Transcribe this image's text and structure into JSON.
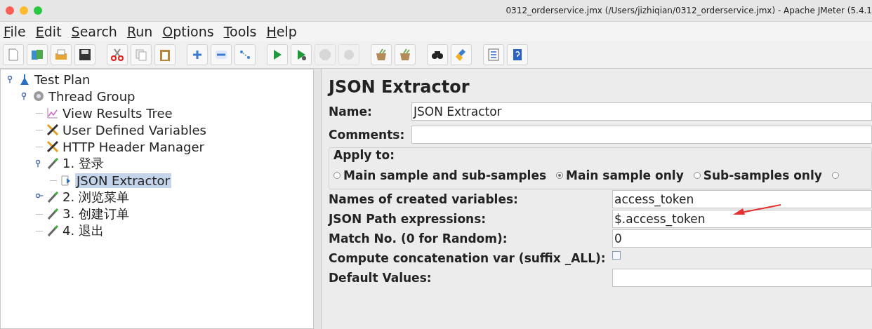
{
  "window": {
    "title": "0312_orderservice.jmx (/Users/jizhiqian/0312_orderservice.jmx) - Apache JMeter (5.4.1"
  },
  "menu": [
    "File",
    "Edit",
    "Search",
    "Run",
    "Options",
    "Tools",
    "Help"
  ],
  "toolbar": [
    {
      "kind": "new",
      "disabled": false
    },
    {
      "kind": "templates",
      "disabled": false
    },
    {
      "kind": "open",
      "disabled": false
    },
    {
      "kind": "save",
      "disabled": false
    },
    {
      "kind": "cut",
      "disabled": false
    },
    {
      "kind": "copy",
      "disabled": false
    },
    {
      "kind": "paste",
      "disabled": false
    },
    {
      "kind": "expand",
      "disabled": false
    },
    {
      "kind": "collapse",
      "disabled": false
    },
    {
      "kind": "toggle",
      "disabled": false
    },
    {
      "kind": "start",
      "disabled": false
    },
    {
      "kind": "start-no-pauses",
      "disabled": false
    },
    {
      "kind": "stop",
      "disabled": true
    },
    {
      "kind": "shutdown",
      "disabled": true
    },
    {
      "kind": "clear",
      "disabled": false
    },
    {
      "kind": "clear-all",
      "disabled": false
    },
    {
      "kind": "search",
      "disabled": false
    },
    {
      "kind": "reset-search",
      "disabled": false
    },
    {
      "kind": "function-helper",
      "disabled": false
    },
    {
      "kind": "help",
      "disabled": false
    }
  ],
  "tree": [
    {
      "label": "Test Plan",
      "kind": "testplan",
      "expanded": true,
      "selected": false,
      "children": [
        {
          "label": "Thread Group",
          "kind": "threadgroup",
          "expanded": true,
          "selected": false,
          "children": [
            {
              "label": "View Results Tree",
              "kind": "listener",
              "selected": false
            },
            {
              "label": "User Defined Variables",
              "kind": "config",
              "selected": false
            },
            {
              "label": "HTTP Header Manager",
              "kind": "config",
              "selected": false
            },
            {
              "label": "1. 登录",
              "kind": "sampler",
              "expanded": true,
              "selected": false,
              "children": [
                {
                  "label": "JSON Extractor",
                  "kind": "extractor",
                  "selected": true
                }
              ]
            },
            {
              "label": "2. 浏览菜单",
              "kind": "sampler",
              "expanded": false,
              "selected": false
            },
            {
              "label": "3. 创建订单",
              "kind": "sampler",
              "selected": false
            },
            {
              "label": "4. 退出",
              "kind": "sampler",
              "selected": false
            }
          ]
        }
      ]
    }
  ],
  "panel": {
    "title": "JSON Extractor",
    "name": {
      "label": "Name:",
      "value": "JSON Extractor"
    },
    "comments": {
      "label": "Comments:"
    },
    "apply_to": {
      "legend": "Apply to:",
      "options": [
        {
          "label": "Main sample and sub-samples",
          "selected": false
        },
        {
          "label": "Main sample only",
          "selected": true
        },
        {
          "label": "Sub-samples only",
          "selected": false
        },
        {
          "selected": false
        }
      ]
    },
    "fields": [
      {
        "kind": "text",
        "label": "Names of created variables:",
        "value": "access_token"
      },
      {
        "kind": "text",
        "label": "JSON Path expressions:",
        "value": "$.access_token",
        "annotated": true
      },
      {
        "kind": "text",
        "label": "Match No. (0 for Random):",
        "value": "0"
      },
      {
        "kind": "checkbox",
        "label": "Compute concatenation var (suffix _ALL):",
        "checked": false
      },
      {
        "kind": "text",
        "label": "Default Values:"
      }
    ]
  }
}
